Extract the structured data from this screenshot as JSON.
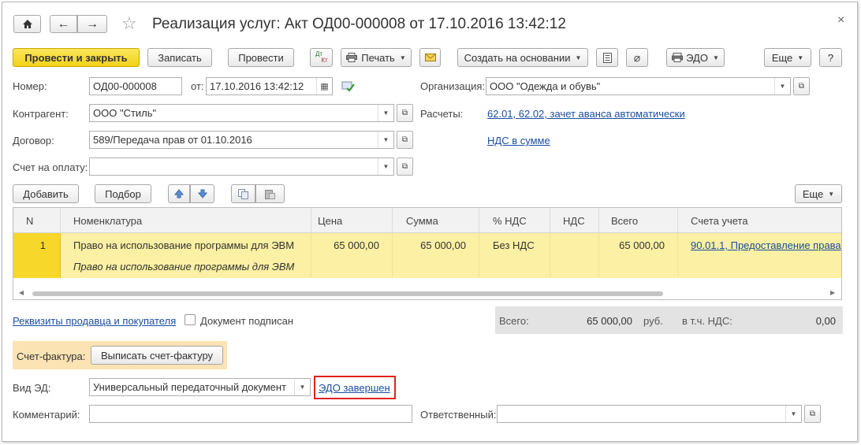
{
  "window": {
    "title": "Реализация услуг: Акт ОД00-000008 от 17.10.2016 13:42:12"
  },
  "toolbar": {
    "post_close": "Провести и закрыть",
    "write": "Записать",
    "post": "Провести",
    "dtkt_top": "Дт",
    "dtkt_bottom": "Кт",
    "print": "Печать",
    "create_based": "Создать на основании",
    "edo": "ЭДО",
    "more": "Еще",
    "help": "?"
  },
  "header": {
    "number_label": "Номер:",
    "number_value": "ОД00-000008",
    "date_label": "от:",
    "date_value": "17.10.2016 13:42:12",
    "org_label": "Организация:",
    "org_value": "ООО \"Одежда и обувь\"",
    "contractor_label": "Контрагент:",
    "contractor_value": "ООО \"Стиль\"",
    "settlements_label": "Расчеты:",
    "settlements_link": "62.01, 62.02, зачет аванса автоматически",
    "contract_label": "Договор:",
    "contract_value": "589/Передача прав от 01.10.2016",
    "vat_link": "НДС в сумме",
    "invoice_label": "Счет на оплату:",
    "invoice_value": ""
  },
  "table_toolbar": {
    "add": "Добавить",
    "select": "Подбор",
    "more": "Еще"
  },
  "table": {
    "columns": [
      "N",
      "Номенклатура",
      "Цена",
      "Сумма",
      "% НДС",
      "НДС",
      "Всего",
      "Счета учета"
    ],
    "rows": [
      {
        "n": "1",
        "nomenclature": "Право на использование программы для ЭВМ",
        "content": "Право на использование программы для ЭВМ",
        "price": "65 000,00",
        "sum": "65 000,00",
        "vat_rate": "Без НДС",
        "vat": "",
        "total": "65 000,00",
        "accounts": "90.01.1, Предоставление права"
      }
    ]
  },
  "footer": {
    "requisites_link": "Реквизиты продавца и покупателя",
    "signed_label": "Документ подписан",
    "signed_checked": false,
    "total_label": "Всего:",
    "total_value": "65 000,00",
    "currency": "руб.",
    "vat_incl_label": "в т.ч. НДС:",
    "vat_incl_value": "0,00",
    "invoice_section_label": "Счет-фактура:",
    "issue_invoice_button": "Выписать счет-фактуру",
    "ed_type_label": "Вид ЭД:",
    "ed_type_value": "Универсальный передаточный документ",
    "edo_status_link": "ЭДО завершен",
    "comment_label": "Комментарий:",
    "comment_value": "",
    "responsible_label": "Ответственный:",
    "responsible_value": ""
  },
  "colors": {
    "primary_button": "#f3d21a",
    "selected_row": "#fbf0a3",
    "link": "#1a4ea0",
    "highlight_border": "#e0201e",
    "invoice_section_bg": "#fbe3b3"
  }
}
